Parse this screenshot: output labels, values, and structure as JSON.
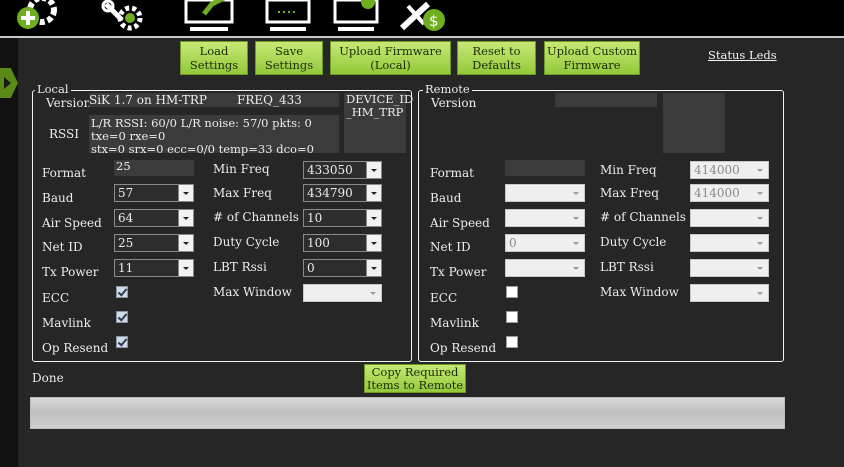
{
  "toolbar": {
    "icons": [
      "add-gear-icon",
      "wrench-gear-icon",
      "monitor-check-icon",
      "monitor-dots-icon",
      "monitor-info-icon",
      "plug-dollar-icon"
    ]
  },
  "actions": {
    "load_settings": "Load Settings",
    "save_settings": "Save Settings",
    "upload_firmware_1": "Upload Firmware",
    "upload_firmware_2": "(Local)",
    "reset_1": "Reset to",
    "reset_2": "Defaults",
    "upload_custom_1": "Upload Custom",
    "upload_custom_2": "Firmware",
    "status_leds": "Status Leds"
  },
  "local": {
    "title": "Local",
    "version_label": "Version",
    "version_value": "SiK 1.7 on HM-TRP",
    "freq_value": "FREQ_433",
    "device_id_1": "DEVICE_ID",
    "device_id_2": "_HM_TRP",
    "rssi_label": "RSSI",
    "rssi_line1": "L/R RSSI: 60/0  L/R noise: 57/0 pkts: 0  txe=0 rxe=0",
    "rssi_line2": "stx=0 srx=0 ecc=0/0 temp=33 dco=0",
    "format_label": "Format",
    "format_value": "25",
    "baud_label": "Baud",
    "baud_value": "57",
    "air_speed_label": "Air Speed",
    "air_speed_value": "64",
    "net_id_label": "Net ID",
    "net_id_value": "25",
    "tx_power_label": "Tx Power",
    "tx_power_value": "11",
    "ecc_label": "ECC",
    "ecc_checked": true,
    "mavlink_label": "Mavlink",
    "mavlink_checked": true,
    "op_resend_label": "Op Resend",
    "op_resend_checked": true,
    "min_freq_label": "Min Freq",
    "min_freq_value": "433050",
    "max_freq_label": "Max Freq",
    "max_freq_value": "434790",
    "channels_label": "# of Channels",
    "channels_value": "10",
    "duty_cycle_label": "Duty Cycle",
    "duty_cycle_value": "100",
    "lbt_rssi_label": "LBT Rssi",
    "lbt_rssi_value": "0",
    "max_window_label": "Max Window",
    "max_window_value": ""
  },
  "remote": {
    "title": "Remote",
    "version_label": "Version",
    "format_label": "Format",
    "baud_label": "Baud",
    "air_speed_label": "Air Speed",
    "net_id_label": "Net ID",
    "net_id_value": "0",
    "tx_power_label": "Tx Power",
    "ecc_label": "ECC",
    "ecc_checked": false,
    "mavlink_label": "Mavlink",
    "mavlink_checked": false,
    "op_resend_label": "Op Resend",
    "op_resend_checked": false,
    "min_freq_label": "Min Freq",
    "min_freq_value": "414000",
    "max_freq_label": "Max Freq",
    "max_freq_value": "414000",
    "channels_label": "# of Channels",
    "duty_cycle_label": "Duty Cycle",
    "lbt_rssi_label": "LBT Rssi",
    "max_window_label": "Max Window"
  },
  "footer": {
    "status": "Done",
    "copy_1": "Copy Required",
    "copy_2": "Items to Remote",
    "progress": 0
  },
  "colors": {
    "accent": "#93c93a",
    "background": "#262626",
    "toolbar": "#000000"
  }
}
